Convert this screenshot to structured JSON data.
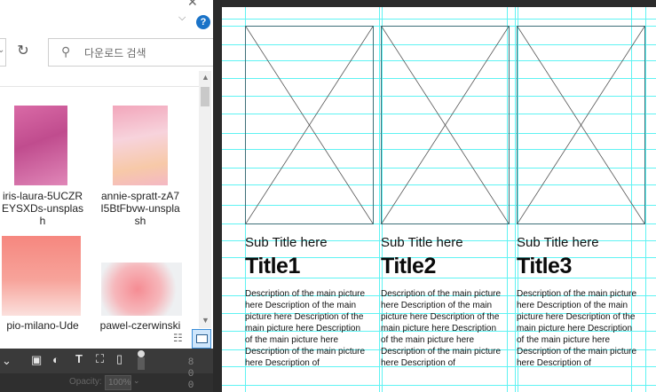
{
  "explorer": {
    "search_placeholder": "다운로드 검색",
    "items": [
      {
        "label": "iris-laura-5UCZREYSXDs-unsplash",
        "lines": [
          "iris-laura-5UCZR",
          "EYSXDs-unsplas",
          "h"
        ]
      },
      {
        "label": "annie-spratt-zA7I5BtFbvw-unsplash",
        "lines": [
          "annie-spratt-zA7",
          "I5BtFbvw-unspla",
          "sh"
        ]
      },
      {
        "label": "pio-milano-Ude",
        "lines": [
          "pio-milano-Ude"
        ]
      },
      {
        "label": "pawel-czerwinski",
        "lines": [
          "pawel-czerwinski"
        ]
      }
    ]
  },
  "photoshop": {
    "opacity_label": "Opacity:",
    "opacity_value": "100%",
    "ruler_digits": [
      "8",
      "0",
      "0"
    ]
  },
  "cards": [
    {
      "subtitle": "Sub Title here",
      "title": "Title1",
      "description": "Description of the main picture here Description of the main picture here Description of the main picture here Description of the main picture here Description of the main picture here Description of"
    },
    {
      "subtitle": "Sub Title here",
      "title": "Title2",
      "description": "Description of the main picture here Description of the main picture here Description of the main picture here Description of the main picture here Description of the main picture here Description of"
    },
    {
      "subtitle": "Sub Title here",
      "title": "Title3",
      "description": "Description of the main picture here Description of the main picture here Description of the main picture here Description of the main picture here Description of the main picture here Description of"
    }
  ],
  "colors": {
    "guide": "#5ff3f3",
    "placeholder_border": "#3e6f78",
    "canvas_bg": "#ffffff"
  }
}
